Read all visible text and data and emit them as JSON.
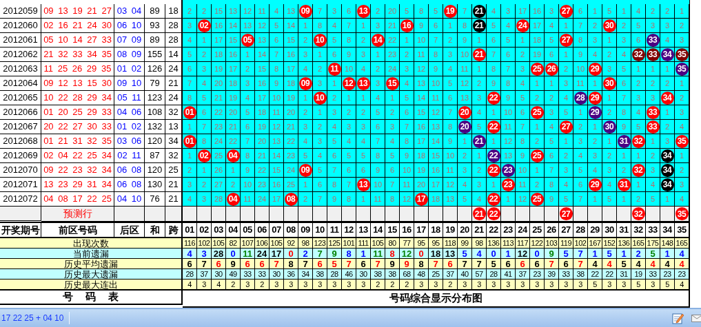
{
  "draw_rows": [
    {
      "issue": "2012059",
      "front": "09 13 19 21 27",
      "back": "03 04",
      "sum": "89",
      "span": "18",
      "cells": [
        "2",
        "2",
        "15",
        "13",
        "12",
        "11",
        "4",
        "13",
        {
          "text": "09",
          "color": "#ff0000"
        },
        "7",
        "3",
        "6",
        {
          "text": "13",
          "color": "#ff0000"
        },
        "2",
        "20",
        "5",
        "8",
        "5",
        {
          "text": "19",
          "color": "#ff0000"
        },
        "7",
        {
          "text": "21",
          "color": "#000000"
        },
        "4",
        "3",
        "17",
        "16",
        "3",
        {
          "text": "27",
          "color": "#ff0000"
        },
        "6",
        "1",
        "5",
        "1",
        "4",
        "2",
        "2",
        "1"
      ]
    },
    {
      "issue": "2012060",
      "front": "02 16 21 24 30",
      "back": "06 10",
      "sum": "93",
      "span": "28",
      "cells": [
        "3",
        {
          "text": "02",
          "color": "#ff0000"
        },
        "16",
        "14",
        "13",
        "12",
        "5",
        "14",
        "1",
        "8",
        "4",
        "7",
        "1",
        "3",
        "21",
        {
          "text": "16",
          "color": "#ff0000"
        },
        "9",
        "6",
        "1",
        "8",
        {
          "text": "21",
          "color": "#000000"
        },
        "5",
        "4",
        {
          "text": "24",
          "color": "#ff0000"
        },
        "17",
        "4",
        "1",
        "7",
        "2",
        {
          "text": "30",
          "color": "#ff0000"
        },
        "2",
        "5",
        "3",
        "3",
        "2"
      ]
    },
    {
      "issue": "2012061",
      "front": "05 10 14 27 33",
      "back": "07 09",
      "sum": "89",
      "span": "28",
      "cells": [
        "4",
        "1",
        "17",
        "15",
        {
          "text": "05",
          "color": "#ff0000"
        },
        "13",
        "6",
        "15",
        "2",
        {
          "text": "10",
          "color": "#ff0000"
        },
        "5",
        "8",
        "2",
        {
          "text": "14",
          "color": "#ff0000"
        },
        "22",
        "1",
        "10",
        "7",
        "2",
        "9",
        "1",
        "6",
        "5",
        "1",
        "18",
        "5",
        {
          "text": "27",
          "color": "#ff0000"
        },
        "8",
        "3",
        "1",
        "3",
        "6",
        {
          "text": "33",
          "color": "#4b0082"
        },
        "4",
        "3"
      ]
    },
    {
      "issue": "2012062",
      "front": "21 32 33 34 35",
      "back": "08 09",
      "sum": "155",
      "span": "14",
      "cells": [
        "5",
        "2",
        "18",
        "16",
        "1",
        "14",
        "7",
        "16",
        "3",
        "1",
        "6",
        "9",
        "3",
        "1",
        "23",
        "2",
        "11",
        "8",
        "3",
        "10",
        {
          "text": "21",
          "color": "#ff0000"
        },
        "7",
        "6",
        "2",
        "19",
        "6",
        "1",
        "9",
        "4",
        "2",
        "4",
        {
          "text": "32",
          "color": "#800000"
        },
        {
          "text": "33",
          "color": "#800000"
        },
        {
          "text": "34",
          "color": "#4b0082"
        },
        {
          "text": "35",
          "color": "#800000"
        }
      ]
    },
    {
      "issue": "2012063",
      "front": "11 25 26 29 35",
      "back": "01 02",
      "sum": "126",
      "span": "24",
      "cells": [
        "6",
        "3",
        "19",
        "17",
        "2",
        "15",
        "8",
        "17",
        "4",
        "2",
        {
          "text": "11",
          "color": "#ff0000"
        },
        "10",
        "4",
        "2",
        "24",
        "3",
        "12",
        "9",
        "4",
        "11",
        "1",
        "8",
        "7",
        "3",
        {
          "text": "25",
          "color": "#ff0000"
        },
        {
          "text": "26",
          "color": "#ff0000"
        },
        "2",
        "10",
        {
          "text": "29",
          "color": "#ff0000"
        },
        "3",
        "5",
        "1",
        "1",
        "1",
        {
          "text": "35",
          "color": "#4b0082"
        }
      ]
    },
    {
      "issue": "2012064",
      "front": "09 12 13 15 30",
      "back": "09 10",
      "sum": "79",
      "span": "21",
      "cells": [
        "7",
        "4",
        "20",
        "18",
        "3",
        "16",
        "9",
        "18",
        {
          "text": "09",
          "color": "#ff0000"
        },
        "3",
        "1",
        {
          "text": "12",
          "color": "#ff0000"
        },
        {
          "text": "13",
          "color": "#ff0000"
        },
        "3",
        {
          "text": "15",
          "color": "#ff0000"
        },
        "4",
        "13",
        "10",
        "5",
        "12",
        "2",
        "9",
        "8",
        "4",
        "1",
        "1",
        "3",
        "11",
        "1",
        {
          "text": "30",
          "color": "#ff0000"
        },
        "6",
        "2",
        "2",
        "2",
        "1"
      ]
    },
    {
      "issue": "2012065",
      "front": "10 22 28 29 34",
      "back": "05 11",
      "sum": "123",
      "span": "24",
      "cells": [
        "8",
        "5",
        "21",
        "19",
        "4",
        "17",
        "10",
        "19",
        "1",
        {
          "text": "10",
          "color": "#ff0000"
        },
        "2",
        "1",
        "1",
        "4",
        "1",
        "5",
        "14",
        "11",
        "6",
        "13",
        "3",
        {
          "text": "22",
          "color": "#ff0000"
        },
        "9",
        "5",
        "2",
        "2",
        "4",
        {
          "text": "28",
          "color": "#4b0082"
        },
        {
          "text": "29",
          "color": "#ff0000"
        },
        "1",
        "7",
        "3",
        "3",
        {
          "text": "34",
          "color": "#ff0000"
        },
        "2"
      ]
    },
    {
      "issue": "2012066",
      "front": "01 20 25 29 33",
      "back": "04 06",
      "sum": "108",
      "span": "32",
      "cells": [
        {
          "text": "01",
          "color": "#ff0000"
        },
        "6",
        "22",
        "20",
        "5",
        "18",
        "11",
        "20",
        "2",
        "1",
        "3",
        "2",
        "2",
        "5",
        "2",
        "6",
        "15",
        "12",
        "7",
        {
          "text": "20",
          "color": "#ff0000"
        },
        "4",
        "1",
        "10",
        "6",
        {
          "text": "25",
          "color": "#ff0000"
        },
        "3",
        "5",
        "1",
        {
          "text": "29",
          "color": "#4b0082"
        },
        "2",
        "8",
        "4",
        {
          "text": "33",
          "color": "#ff0000"
        },
        "1",
        "3"
      ]
    },
    {
      "issue": "2012067",
      "front": "20 22 27 30 33",
      "back": "01 02",
      "sum": "132",
      "span": "13",
      "cells": [
        "1",
        "7",
        "23",
        "21",
        "6",
        "19",
        "12",
        "21",
        "3",
        "2",
        "4",
        "3",
        "3",
        "6",
        "3",
        "7",
        "16",
        "13",
        "8",
        {
          "text": "20",
          "color": "#4b0082"
        },
        "5",
        {
          "text": "22",
          "color": "#ff0000"
        },
        "11",
        "7",
        "1",
        "4",
        {
          "text": "27",
          "color": "#ff0000"
        },
        "2",
        "1",
        {
          "text": "30",
          "color": "#4b0082"
        },
        "9",
        "5",
        {
          "text": "33",
          "color": "#ff0000"
        },
        "2",
        "4"
      ]
    },
    {
      "issue": "2012068",
      "front": "01 21 31 32 35",
      "back": "03 06",
      "sum": "120",
      "span": "34",
      "cells": [
        {
          "text": "01",
          "color": "#ff0000"
        },
        "8",
        "24",
        "22",
        "7",
        "20",
        "13",
        "22",
        "4",
        "3",
        "5",
        "4",
        "4",
        "7",
        "4",
        "8",
        "17",
        "14",
        "9",
        "1",
        {
          "text": "21",
          "color": "#4b0082"
        },
        "1",
        "12",
        "8",
        "2",
        "5",
        "1",
        "3",
        "2",
        "1",
        {
          "text": "31",
          "color": "#4b0082"
        },
        {
          "text": "32",
          "color": "#ff0000"
        },
        "1",
        "3",
        {
          "text": "35",
          "color": "#ff0000"
        }
      ]
    },
    {
      "issue": "2012069",
      "front": "02 04 22 25 34",
      "back": "02 11",
      "sum": "87",
      "span": "32",
      "cells": [
        "1",
        {
          "text": "02",
          "color": "#ff0000"
        },
        "25",
        {
          "text": "04",
          "color": "#ff0000"
        },
        "8",
        "21",
        "14",
        "23",
        "5",
        "4",
        "6",
        "5",
        "5",
        "8",
        "5",
        "9",
        "18",
        "15",
        "10",
        "2",
        "1",
        {
          "text": "22",
          "color": "#4b0082"
        },
        "13",
        "9",
        {
          "text": "25",
          "color": "#ff0000"
        },
        "6",
        "2",
        "4",
        "3",
        "2",
        "1",
        "1",
        "2",
        {
          "text": "34",
          "color": "#000000"
        },
        "1"
      ]
    },
    {
      "issue": "2012070",
      "front": "09 22 23 32 34",
      "back": "06 08",
      "sum": "120",
      "span": "25",
      "cells": [
        "2",
        "1",
        "26",
        "1",
        "9",
        "22",
        "15",
        "24",
        {
          "text": "09",
          "color": "#ff0000"
        },
        "5",
        "7",
        "6",
        "6",
        "9",
        "6",
        "10",
        "19",
        "16",
        "11",
        "3",
        "2",
        {
          "text": "22",
          "color": "#ff0000"
        },
        {
          "text": "23",
          "color": "#4b0082"
        },
        "10",
        "1",
        "7",
        "3",
        "5",
        "4",
        "3",
        "2",
        {
          "text": "32",
          "color": "#ff0000"
        },
        "3",
        {
          "text": "34",
          "color": "#000000"
        },
        "2"
      ]
    },
    {
      "issue": "2012071",
      "front": "13 23 29 31 34",
      "back": "06 08",
      "sum": "130",
      "span": "21",
      "cells": [
        "3",
        "2",
        "27",
        "2",
        "10",
        "23",
        "16",
        "25",
        "1",
        "6",
        "8",
        "7",
        {
          "text": "13",
          "color": "#ff0000"
        },
        "10",
        "7",
        "11",
        "20",
        "17",
        "12",
        "4",
        "3",
        "1",
        {
          "text": "23",
          "color": "#ff0000"
        },
        "11",
        "2",
        "8",
        "4",
        "6",
        {
          "text": "29",
          "color": "#ff0000"
        },
        "4",
        {
          "text": "31",
          "color": "#ff0000"
        },
        "1",
        "4",
        {
          "text": "34",
          "color": "#000000"
        },
        "3"
      ]
    },
    {
      "issue": "2012072",
      "front": "04 08 17 22 25",
      "back": "04 10",
      "sum": "76",
      "span": "21",
      "cells": [
        "4",
        "3",
        "28",
        {
          "text": "04",
          "color": "#ff0000"
        },
        "11",
        "24",
        "17",
        {
          "text": "08",
          "color": "#ff0000"
        },
        "2",
        "7",
        "9",
        "8",
        "1",
        "11",
        "8",
        "12",
        {
          "text": "17",
          "color": "#ff0000"
        },
        "18",
        "13",
        "5",
        "4",
        {
          "text": "22",
          "color": "#ff0000"
        },
        "1",
        "12",
        {
          "text": "25",
          "color": "#ff0000"
        },
        "9",
        "5",
        "7",
        "1",
        "5",
        "1",
        "2",
        "5",
        "1",
        "4"
      ]
    }
  ],
  "predict_row": {
    "label": "预测行",
    "cells": [
      {},
      {},
      {},
      {},
      {},
      {},
      {},
      {},
      {},
      {},
      {},
      {},
      {},
      {},
      {},
      {},
      {},
      {},
      {},
      {},
      {
        "text": "21",
        "color": "#ff0000"
      },
      {
        "text": "22",
        "color": "#ff0000"
      },
      {},
      {},
      {},
      {},
      {
        "text": "27",
        "color": "#ff0000"
      },
      {},
      {},
      {},
      {},
      {
        "text": "32",
        "color": "#ff0000"
      },
      {},
      {},
      {
        "text": "35",
        "color": "#ff0000"
      }
    ]
  },
  "header": {
    "issue": "开奖期号",
    "front": "前区号码",
    "back": "后区",
    "sum": "和",
    "span": "跨",
    "numbers": [
      "01",
      "02",
      "03",
      "04",
      "05",
      "06",
      "07",
      "08",
      "09",
      "10",
      "11",
      "12",
      "13",
      "14",
      "15",
      "16",
      "17",
      "18",
      "19",
      "20",
      "21",
      "22",
      "23",
      "24",
      "25",
      "26",
      "27",
      "28",
      "29",
      "30",
      "31",
      "32",
      "33",
      "34",
      "35"
    ]
  },
  "stats": [
    {
      "label": "出现次数",
      "values": [
        "116",
        "102",
        "105",
        "82",
        "107",
        "106",
        "105",
        "92",
        "98",
        "123",
        "125",
        "101",
        "111",
        "105",
        "80",
        "77",
        "95",
        "95",
        "118",
        "99",
        "98",
        "136",
        "113",
        "117",
        "122",
        "103",
        "119",
        "102",
        "167",
        "152",
        "136",
        "165",
        "175",
        "148",
        "165"
      ]
    },
    {
      "label": "当前遗漏",
      "values": [
        {
          "text": "4",
          "color": "#0000ff"
        },
        {
          "text": "3",
          "color": "#0000ff"
        },
        {
          "text": "28",
          "color": "#000000"
        },
        {
          "text": "0",
          "color": "#0000ff"
        },
        {
          "text": "11",
          "color": "#008000"
        },
        {
          "text": "24",
          "color": "#000000"
        },
        {
          "text": "17",
          "color": "#000000"
        },
        {
          "text": "0",
          "color": "#ff0000"
        },
        {
          "text": "2",
          "color": "#0000ff"
        },
        {
          "text": "7",
          "color": "#008000"
        },
        {
          "text": "9",
          "color": "#008000"
        },
        {
          "text": "8",
          "color": "#0000ff"
        },
        {
          "text": "1",
          "color": "#0000ff"
        },
        {
          "text": "11",
          "color": "#008000"
        },
        {
          "text": "8",
          "color": "#ff0000"
        },
        {
          "text": "12",
          "color": "#008000"
        },
        {
          "text": "0",
          "color": "#ff0000"
        },
        {
          "text": "18",
          "color": "#000000"
        },
        {
          "text": "13",
          "color": "#000000"
        },
        {
          "text": "5",
          "color": "#0000ff"
        },
        {
          "text": "4",
          "color": "#0000ff"
        },
        {
          "text": "0",
          "color": "#0000ff"
        },
        {
          "text": "1",
          "color": "#0000ff"
        },
        {
          "text": "12",
          "color": "#000000"
        },
        {
          "text": "0",
          "color": "#0000ff"
        },
        {
          "text": "9",
          "color": "#008000"
        },
        {
          "text": "5",
          "color": "#0000ff"
        },
        {
          "text": "7",
          "color": "#0000ff"
        },
        {
          "text": "1",
          "color": "#0000ff"
        },
        {
          "text": "5",
          "color": "#0000ff"
        },
        {
          "text": "1",
          "color": "#0000ff"
        },
        {
          "text": "2",
          "color": "#0000ff"
        },
        {
          "text": "5",
          "color": "#008000"
        },
        {
          "text": "1",
          "color": "#0000ff"
        },
        {
          "text": "4",
          "color": "#0000ff"
        }
      ]
    },
    {
      "label": "历史平均遗漏",
      "values": [
        {
          "text": "6",
          "color": "#000000"
        },
        {
          "text": "7",
          "color": "#000000"
        },
        {
          "text": "6",
          "color": "#ff0000"
        },
        {
          "text": "9",
          "color": "#000000"
        },
        {
          "text": "6",
          "color": "#ff0000"
        },
        {
          "text": "6",
          "color": "#ff0000"
        },
        {
          "text": "7",
          "color": "#ff0000"
        },
        {
          "text": "8",
          "color": "#000000"
        },
        {
          "text": "7",
          "color": "#000000"
        },
        {
          "text": "6",
          "color": "#ff0000"
        },
        {
          "text": "5",
          "color": "#ff0000"
        },
        {
          "text": "7",
          "color": "#ff0000"
        },
        {
          "text": "6",
          "color": "#000000"
        },
        {
          "text": "7",
          "color": "#ff0000"
        },
        {
          "text": "9",
          "color": "#000000"
        },
        {
          "text": "9",
          "color": "#ff0000"
        },
        {
          "text": "8",
          "color": "#000000"
        },
        {
          "text": "7",
          "color": "#ff0000"
        },
        {
          "text": "6",
          "color": "#ff0000"
        },
        {
          "text": "7",
          "color": "#000000"
        },
        {
          "text": "7",
          "color": "#000000"
        },
        {
          "text": "5",
          "color": "#000000"
        },
        {
          "text": "6",
          "color": "#000000"
        },
        {
          "text": "6",
          "color": "#ff0000"
        },
        {
          "text": "6",
          "color": "#000000"
        },
        {
          "text": "7",
          "color": "#ff0000"
        },
        {
          "text": "6",
          "color": "#000000"
        },
        {
          "text": "7",
          "color": "#ff0000"
        },
        {
          "text": "4",
          "color": "#000000"
        },
        {
          "text": "4",
          "color": "#ff0000"
        },
        {
          "text": "5",
          "color": "#000000"
        },
        {
          "text": "4",
          "color": "#000000"
        },
        {
          "text": "4",
          "color": "#ff0000"
        },
        {
          "text": "4",
          "color": "#000000"
        },
        {
          "text": "4",
          "color": "#ff0000"
        }
      ]
    },
    {
      "label": "历史最大遗漏",
      "values": [
        "28",
        "37",
        "30",
        "49",
        "33",
        "33",
        "30",
        "36",
        "34",
        "38",
        "28",
        "46",
        "30",
        "38",
        "38",
        "68",
        "48",
        "25",
        "37",
        "40",
        "57",
        "28",
        "41",
        "37",
        "23",
        "39",
        "33",
        "38",
        "22",
        "22",
        "31",
        "19",
        "33",
        "23",
        "23"
      ]
    },
    {
      "label": "历史最大连出",
      "values": [
        "4",
        "3",
        "4",
        "2",
        "3",
        "2",
        "3",
        "3",
        "3",
        "3",
        "3",
        "3",
        "3",
        "2",
        "2",
        "2",
        "3",
        "3",
        "2",
        "3",
        "3",
        "3",
        "3",
        "3",
        "3",
        "3",
        "3",
        "3",
        "5",
        "3",
        "3",
        "5",
        "3",
        "5",
        "4"
      ]
    }
  ],
  "footer": {
    "left": "号 码 表",
    "right": "号码综合显示分布图"
  },
  "status_bar": {
    "text": "17 22 25 + 04 10"
  }
}
